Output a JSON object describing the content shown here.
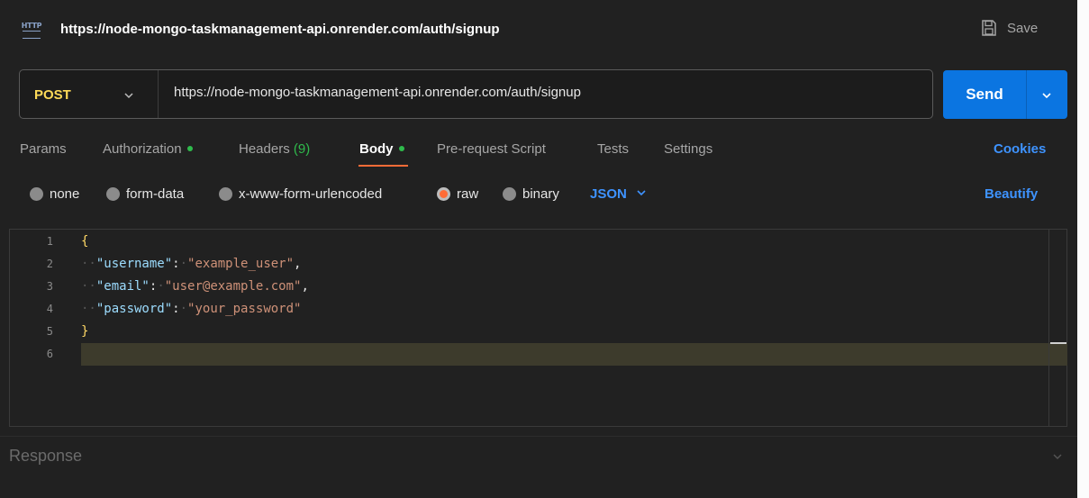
{
  "request": {
    "title": "https://node-mongo-taskmanagement-api.onrender.com/auth/signup",
    "save_label": "Save",
    "http_icon_text": "HTTP",
    "http_icon_name": "http-icon",
    "save_icon_name": "save-icon"
  },
  "url_bar": {
    "method": "POST",
    "url": "https://node-mongo-taskmanagement-api.onrender.com/auth/signup",
    "send_label": "Send"
  },
  "tabs": {
    "items": [
      {
        "label": "Params"
      },
      {
        "label": "Authorization",
        "dot": true
      },
      {
        "label": "Headers",
        "count": "(9)"
      },
      {
        "label": "Body",
        "dot": true,
        "active": true
      },
      {
        "label": "Pre-request Script"
      },
      {
        "label": "Tests"
      },
      {
        "label": "Settings"
      }
    ],
    "cookies_label": "Cookies"
  },
  "body_types": {
    "options": [
      "none",
      "form-data",
      "x-www-form-urlencoded",
      "raw",
      "binary"
    ],
    "selected": "raw",
    "format": "JSON",
    "beautify_label": "Beautify"
  },
  "editor": {
    "line_numbers": [
      "1",
      "2",
      "3",
      "4",
      "5",
      "6"
    ],
    "lines": {
      "l1": "{",
      "l2_key": "\"username\"",
      "l2_val": "\"example_user\"",
      "l3_key": "\"email\"",
      "l3_val": "\"user@example.com\"",
      "l4_key": "\"password\"",
      "l4_val": "\"your_password\"",
      "l5": "}"
    }
  },
  "response": {
    "label": "Response"
  },
  "colors": {
    "accent_orange": "#ff6c37",
    "send_blue": "#0b75e1",
    "link_blue": "#3e93ff",
    "method_yellow": "#fdda58",
    "status_green": "#2fbb4c"
  }
}
